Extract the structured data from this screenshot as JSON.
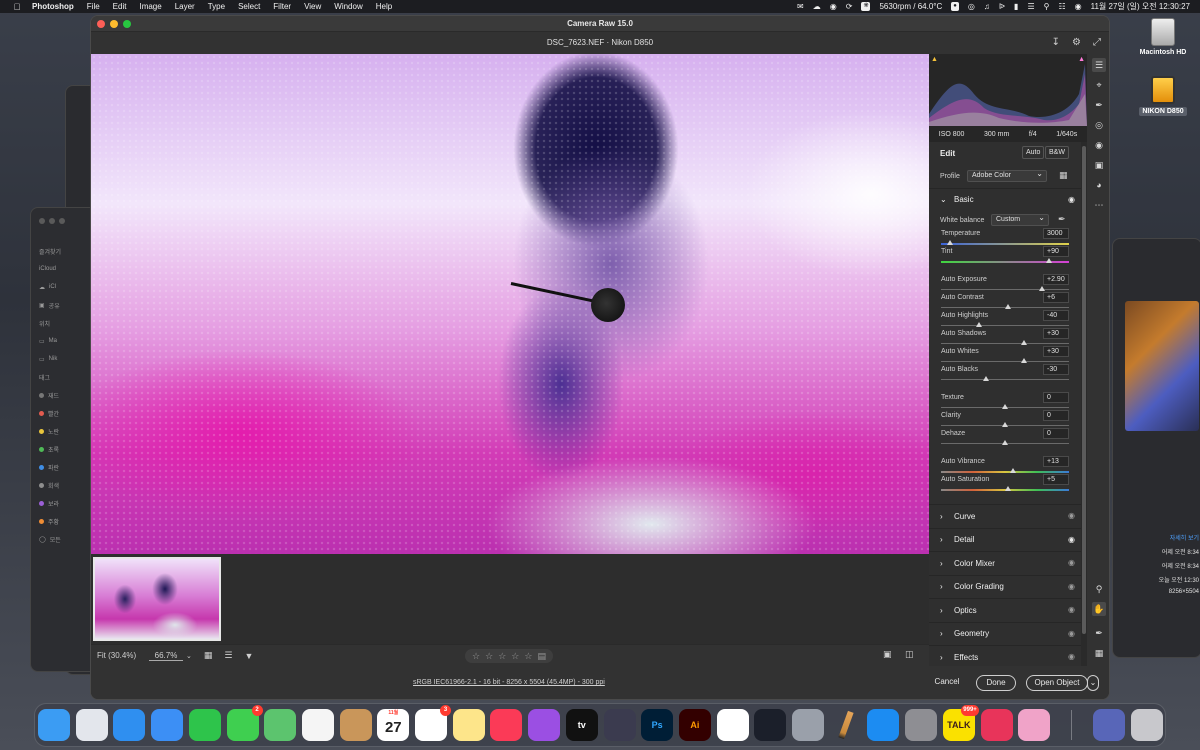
{
  "menubar": {
    "app_name": "Photoshop",
    "menus": [
      "File",
      "Edit",
      "Image",
      "Layer",
      "Type",
      "Select",
      "Filter",
      "View",
      "Window",
      "Help"
    ],
    "fan_status": "5630rpm / 64.0°C",
    "datetime": "11월 27일 (일) 오전 12:30:27"
  },
  "desktop": {
    "icons": [
      {
        "label": "Macintosh HD"
      },
      {
        "label": "NIKON D850"
      }
    ]
  },
  "finder_left": {
    "items": [
      "즐겨찾기",
      "iCloud",
      "iCl",
      "공유",
      "위치",
      "Ma",
      "Nik",
      "태그",
      "재드",
      "빨간",
      "노란",
      "초록",
      "파란",
      "회색",
      "보라",
      "주황",
      "모든"
    ]
  },
  "finder_right": {
    "more_link": "자세히 보기",
    "lines": [
      "어제 오전 8:34",
      "어제 오전 8:34",
      "오늘 오전 12:30",
      "8256×5504"
    ]
  },
  "camera_raw": {
    "window_title": "Camera Raw 15.0",
    "file_title": "DSC_7623.NEF  ·  Nikon D850",
    "camera_info": {
      "iso": "ISO 800",
      "focal": "300 mm",
      "aperture": "f/4",
      "shutter": "1/640s"
    },
    "edit": {
      "title": "Edit",
      "auto_label": "Auto",
      "bw_label": "B&W",
      "profile_label": "Profile",
      "profile_value": "Adobe Color",
      "basic_title": "Basic",
      "white_balance_label": "White balance",
      "white_balance_value": "Custom",
      "sliders": [
        {
          "label": "Temperature",
          "value": "3000",
          "position": 0.07,
          "track": "temp"
        },
        {
          "label": "Tint",
          "value": "+90",
          "position": 0.84,
          "track": "tint"
        },
        {
          "label": "Auto Exposure",
          "value": "+2.90",
          "position": 0.79,
          "track": ""
        },
        {
          "label": "Auto Contrast",
          "value": "+6",
          "position": 0.52,
          "track": ""
        },
        {
          "label": "Auto Highlights",
          "value": "-40",
          "position": 0.3,
          "track": ""
        },
        {
          "label": "Auto Shadows",
          "value": "+30",
          "position": 0.65,
          "track": ""
        },
        {
          "label": "Auto Whites",
          "value": "+30",
          "position": 0.65,
          "track": ""
        },
        {
          "label": "Auto Blacks",
          "value": "-30",
          "position": 0.35,
          "track": ""
        },
        {
          "label": "Texture",
          "value": "0",
          "position": 0.5,
          "track": ""
        },
        {
          "label": "Clarity",
          "value": "0",
          "position": 0.5,
          "track": ""
        },
        {
          "label": "Dehaze",
          "value": "0",
          "position": 0.5,
          "track": ""
        },
        {
          "label": "Auto Vibrance",
          "value": "+13",
          "position": 0.56,
          "track": "vib"
        },
        {
          "label": "Auto Saturation",
          "value": "+5",
          "position": 0.52,
          "track": "sat"
        }
      ],
      "sections": [
        {
          "label": "Curve",
          "visible": false
        },
        {
          "label": "Detail",
          "visible": true
        },
        {
          "label": "Color Mixer",
          "visible": false
        },
        {
          "label": "Color Grading",
          "visible": false
        },
        {
          "label": "Optics",
          "visible": false
        },
        {
          "label": "Geometry",
          "visible": false
        },
        {
          "label": "Effects",
          "visible": false
        }
      ]
    },
    "toolbar": {
      "fit_label": "Fit (30.4%)",
      "zoom_value": "66.7%"
    },
    "workflow_link": "sRGB IEC61966-2.1 - 16 bit - 8256 x 5504 (45.4MP) - 300 ppi",
    "buttons": {
      "cancel": "Cancel",
      "done": "Done",
      "open": "Open Object"
    }
  },
  "dock": {
    "apps": [
      {
        "name": "Finder",
        "color": "#3b9cf3"
      },
      {
        "name": "Launchpad",
        "color": "#e3e6ec"
      },
      {
        "name": "Safari",
        "color": "#2f8ff0"
      },
      {
        "name": "Mail",
        "color": "#3c8ff5"
      },
      {
        "name": "FaceTime",
        "color": "#2ec44b"
      },
      {
        "name": "Messages",
        "color": "#3fcf50",
        "badge": "2"
      },
      {
        "name": "Maps",
        "color": "#5cc46e"
      },
      {
        "name": "Photos",
        "color": "#f5f5f5"
      },
      {
        "name": "Contacts",
        "color": "#c9965a"
      },
      {
        "name": "Calendar",
        "color": "#ffffff",
        "cal_month": "11월",
        "cal_day": "27"
      },
      {
        "name": "Reminders",
        "color": "#ffffff",
        "badge": "3"
      },
      {
        "name": "Notes",
        "color": "#fde58a"
      },
      {
        "name": "Music",
        "color": "#fb3a57"
      },
      {
        "name": "Podcasts",
        "color": "#9b4fe3"
      },
      {
        "name": "Apple TV",
        "color": "#111111",
        "text": "tv"
      },
      {
        "name": "Instruments",
        "color": "#3b3b4f"
      },
      {
        "name": "Photoshop",
        "color": "#001e36",
        "text": "Ps"
      },
      {
        "name": "Illustrator",
        "color": "#330000",
        "text": "Ai"
      },
      {
        "name": "Clip Studio",
        "color": "#ffffff"
      },
      {
        "name": "Final Cut",
        "color": "#1b1f2a"
      },
      {
        "name": "Compressor",
        "color": "#9aa0aa"
      },
      {
        "name": "Pencil",
        "color": "rgba(0,0,0,0)"
      },
      {
        "name": "App Store",
        "color": "#1c8cf2"
      },
      {
        "name": "System Preferences",
        "color": "#8e8e93"
      },
      {
        "name": "KakaoTalk",
        "color": "#fae100",
        "text": "TALK",
        "badge": "999+"
      },
      {
        "name": "Creative Cloud",
        "color": "#e8345a"
      },
      {
        "name": "Pinkie",
        "color": "#f0a3c8"
      }
    ],
    "right": [
      {
        "name": "Downloads",
        "color": "#5866b8"
      },
      {
        "name": "Trash",
        "color": "#c8c8cc"
      }
    ]
  }
}
